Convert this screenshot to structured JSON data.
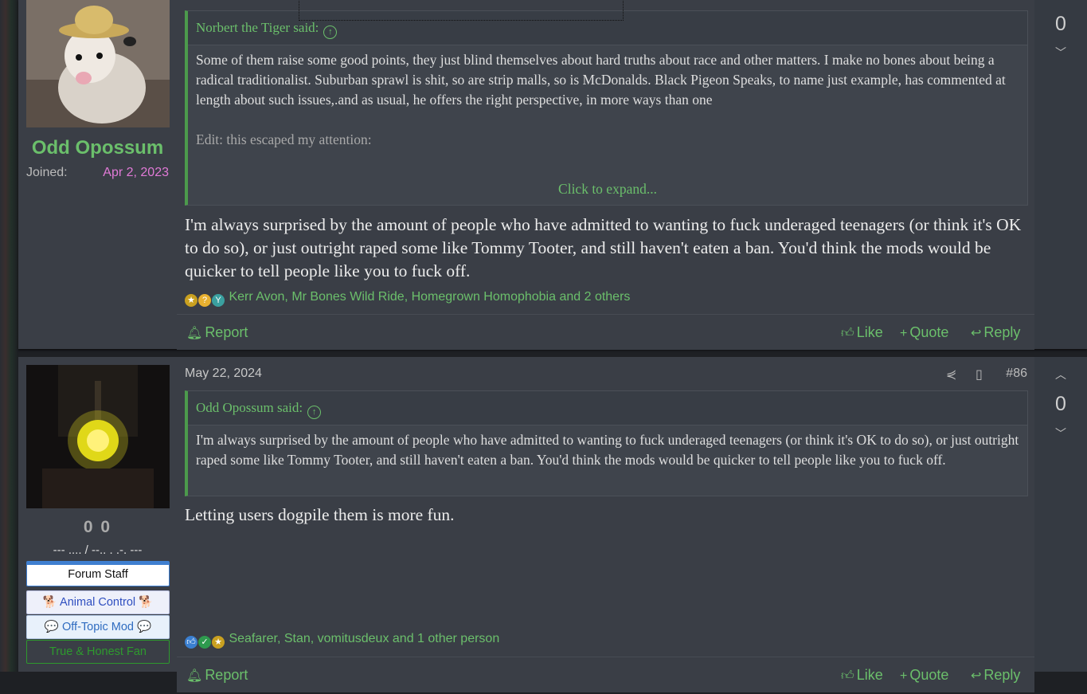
{
  "post1": {
    "username": "Odd Opossum",
    "joined_label": "Joined:",
    "joined_value": "Apr 2, 2023",
    "avatar_icon": "opossum-with-straw-hat-avatar",
    "quote_author": "Norbert the Tiger said:",
    "quote_text": "Some of them raise some good points, they just blind themselves about hard truths about race and other matters. I make no bones about being a radical traditionalist. Suburban sprawl is shit, so are strip malls, so is McDonalds. Black Pigeon Speaks, to name just example, has commented at length about such issues,.and as usual, he offers the right perspective, in more ways than one",
    "quote_edit": "Edit: this escaped my attention:",
    "expand_label": "Click to expand...",
    "body": "I'm always surprised by the amount of people who have admitted to wanting to fuck underaged teenagers (or think it's OK to do so), or just outright raped some like Tommy Tooter, and still haven't eaten a ban. You'd think the mods would be quicker to tell people like you to fuck off.",
    "reactions_text": "Kerr Avon, Mr Bones Wild Ride, Homegrown Homophobia and 2 others",
    "report_label": "Report",
    "like_label": "Like",
    "quote_label": "Quote",
    "reply_label": "Reply",
    "score": "0"
  },
  "post2": {
    "avatar_icon": "glowing-lantern-dark-avatar",
    "stat": "0 0",
    "signature": "--- .... / --.. . .-. ---",
    "banners": [
      "Forum Staff",
      "🐕 Animal Control 🐕",
      "💬 Off-Topic Mod 💬",
      "True & Honest Fan"
    ],
    "date": "May 22, 2024",
    "post_number": "#86",
    "quote_author": "Odd Opossum said:",
    "quote_text": "I'm always surprised by the amount of people who have admitted to wanting to fuck underaged teenagers (or think it's OK to do so), or just outright raped some like Tommy Tooter, and still haven't eaten a ban. You'd think the mods would be quicker to tell people like you to fuck off.",
    "body": "Letting users dogpile them is more fun.",
    "reactions_text": "Seafarer, Stan, vomitusdeux and 1 other person",
    "report_label": "Report",
    "like_label": "Like",
    "quote_label": "Quote",
    "reply_label": "Reply",
    "score": "0"
  },
  "colors": {
    "accent_green": "#6bbf6b",
    "joined_pink": "#e07ad6",
    "post_bg": "#3a3e46",
    "page_bg": "#1e2024"
  }
}
